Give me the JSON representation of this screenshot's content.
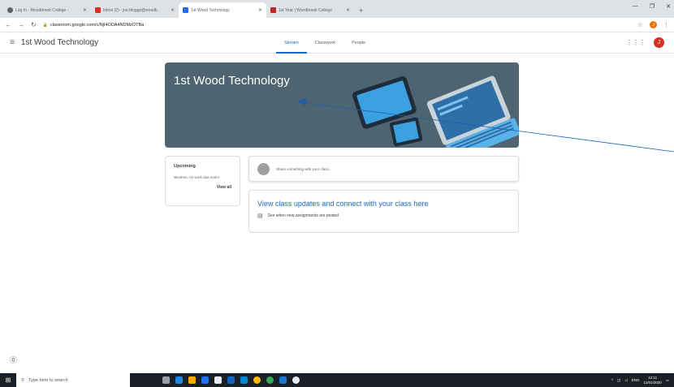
{
  "browser": {
    "tabs": [
      {
        "title": "Log In - Woodbrook College - ",
        "favicon_color": "#5f6368",
        "active": false
      },
      {
        "title": "Inbox (2) - joe.bloggs@woodb",
        "favicon_color": "#d93025",
        "active": false
      },
      {
        "title": "1st Wood Technology",
        "favicon_color": "#1a73e8",
        "active": true
      },
      {
        "title": "1st Year | Woodbrook College",
        "favicon_color": "#c5221f",
        "active": false
      }
    ],
    "new_tab": "+",
    "url": "classroom.google.com/c/NjI4ODA4NDMzOTBa",
    "profile_initial": "J"
  },
  "classroom": {
    "class_name": "1st Wood Technology",
    "tabs": [
      {
        "label": "Stream",
        "active": true
      },
      {
        "label": "Classwork",
        "active": false
      },
      {
        "label": "People",
        "active": false
      }
    ],
    "user_initial": "J",
    "banner_title": "1st Wood Technology",
    "upcoming": {
      "title": "Upcoming",
      "text": "Woohoo, no work due soon!",
      "link": "View all"
    },
    "share_placeholder": "Share something with your class...",
    "info": {
      "title": "View class updates and connect with your class here",
      "row": "See when new assignments are posted"
    },
    "accent_color": "#1967d2",
    "banner_color": "#4e6470"
  },
  "taskbar": {
    "search_placeholder": "Type here to search",
    "lang": "ENG",
    "time": "12:11",
    "date": "11/01/2020"
  },
  "icons": [
    "menu-icon",
    "apps-icon",
    "help-icon",
    "document-icon",
    "lock-icon",
    "star-icon",
    "search-icon",
    "windows-icon"
  ]
}
